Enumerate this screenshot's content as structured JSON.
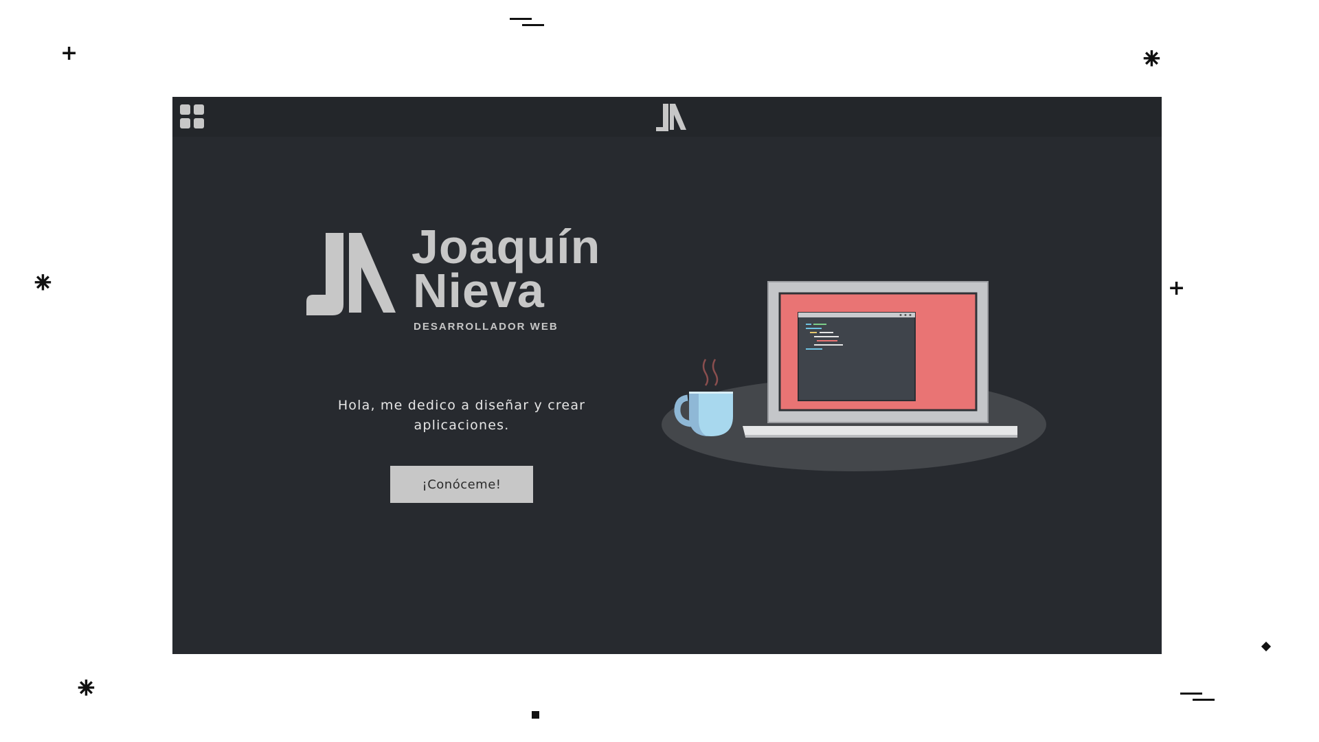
{
  "window": {
    "menu_icon": "grid-menu-icon",
    "top_logo_icon": "jn-logo-icon"
  },
  "hero": {
    "logo_icon": "jn-logo-mark",
    "first_name": "Joaquín",
    "last_name": "Nieva",
    "role": "DESARROLLADOR WEB",
    "intro": "Hola, me dedico a diseñar y crear aplicaciones.",
    "cta_label": "¡Conóceme!"
  },
  "illustration": {
    "icon": "laptop-coffee-illustration"
  },
  "colors": {
    "background": "#272a2f",
    "topbar": "#23262a",
    "text_light": "#c7c7c7",
    "screen_accent": "#e97474",
    "mug": "#a8d8ee"
  }
}
